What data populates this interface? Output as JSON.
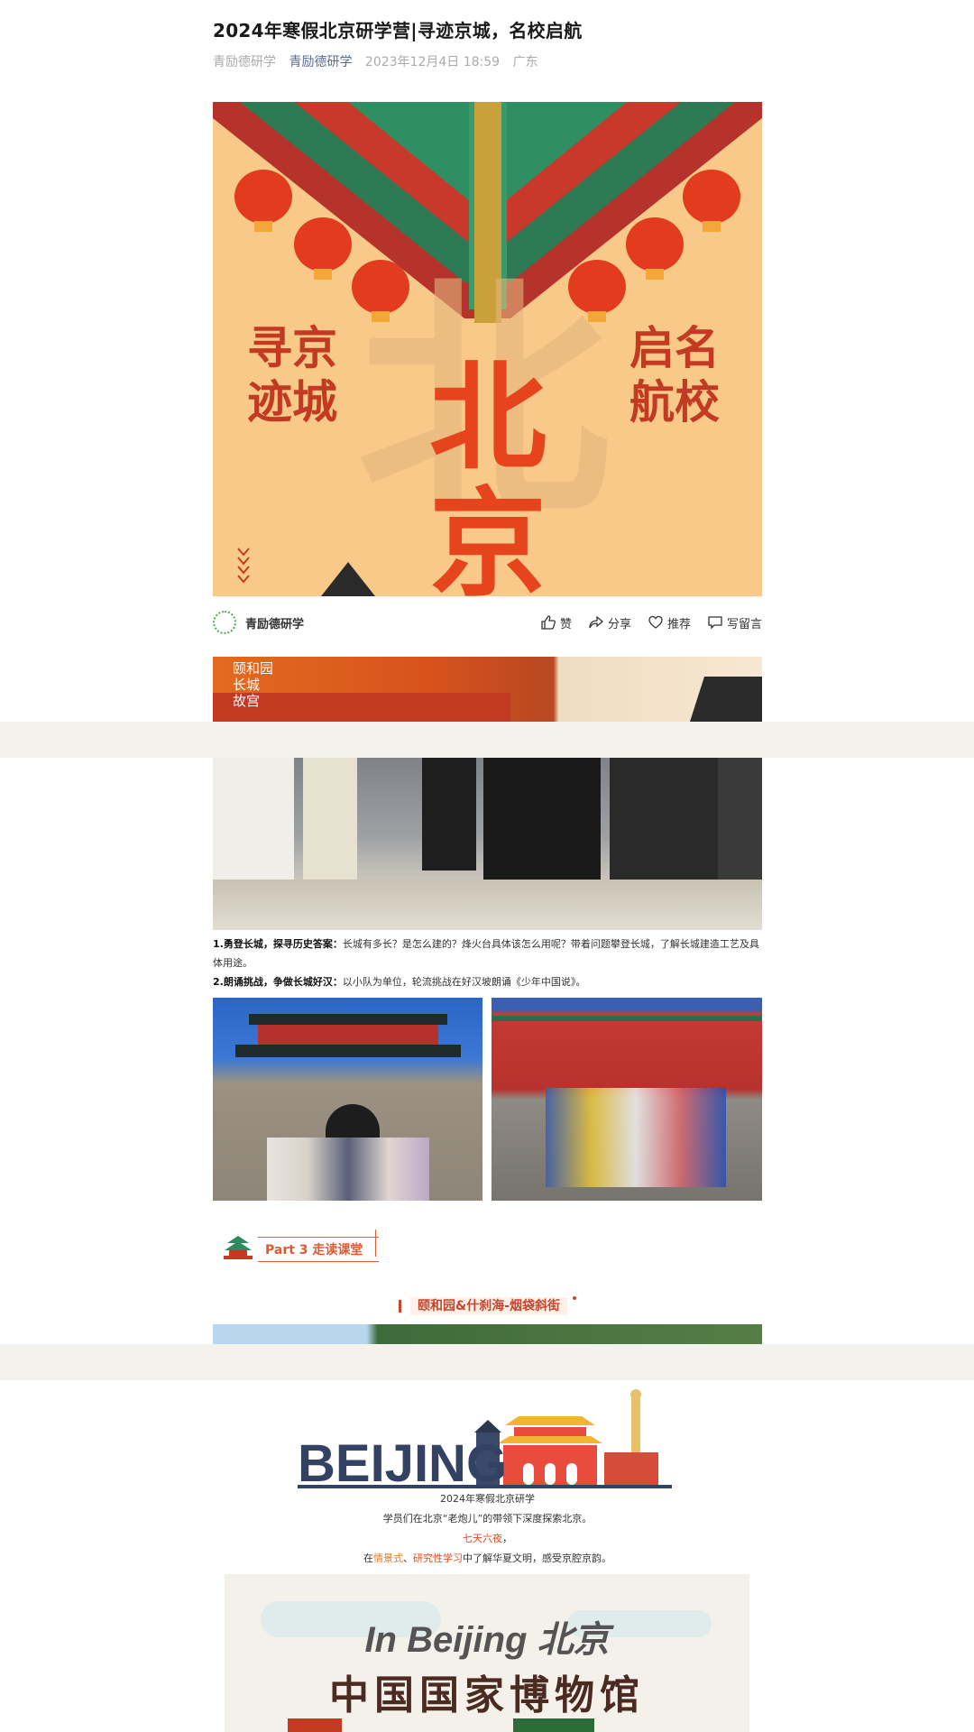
{
  "article": {
    "title": "2024年寒假北京研学营|寻迹京城，名校启航",
    "source": "青励德研学",
    "account": "青励德研学",
    "date": "2023年12月4日 18:59",
    "location": "广东"
  },
  "poster": {
    "left_text_1": "寻京",
    "left_text_2": "迹城",
    "right_text_1": "启名",
    "right_text_2": "航校",
    "main_char_1": "北",
    "main_char_2": "京"
  },
  "action_bar": {
    "account_name": "青励德研学",
    "like_label": "赞",
    "share_label": "分享",
    "recommend_label": "推荐",
    "comment_label": "写留言"
  },
  "strip": {
    "calligraphy_1": "颐和园",
    "calligraphy_2": "长城",
    "calligraphy_3": "故宫"
  },
  "captions": {
    "c1_bold": "1.勇登长城，探寻历史答案：",
    "c1_text": "长城有多长？是怎么建的？烽火台具体该怎么用呢？带着问题攀登长城，了解长城建造工艺及具体用途。",
    "c2_bold": "2.朗诵挑战，争做长城好汉：",
    "c2_text": "以小队为单位，轮流挑战在好汉坡朗诵《少年中国说》。"
  },
  "section": {
    "part_label": "Part 3 走读课堂",
    "subtitle": "颐和园&什刹海-烟袋斜街"
  },
  "beijing_block": {
    "logo_text": "BEIJING",
    "line1": "2024年寒假北京研学",
    "line2": "学员们在北京“老炮儿”的带领下深度探索北京。",
    "line3": "七天六夜",
    "line3_suffix": "，",
    "line4_prefix": "在",
    "line4_hl1": "情景式",
    "line4_sep": "、",
    "line4_hl2": "研究性学习",
    "line4_suffix": "中了解华夏文明，感受京腔京韵。"
  },
  "museum_poster": {
    "line1": "In Beijing  北京",
    "line2": "中国国家博物馆"
  },
  "colors": {
    "accent_red": "#e8471e",
    "account_blue": "#576b95",
    "poster_bg": "#f9c98a",
    "page_gap": "#f3f2ec"
  }
}
